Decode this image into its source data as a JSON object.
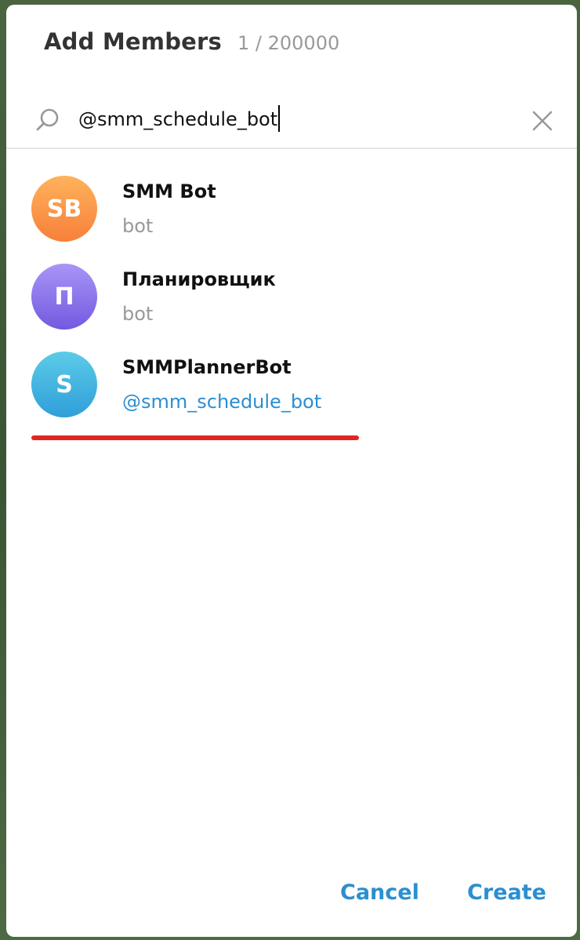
{
  "header": {
    "title": "Add Members",
    "counter": "1 / 200000"
  },
  "search": {
    "value": "@smm_schedule_bot"
  },
  "results": [
    {
      "initials": "SB",
      "name": "SMM Bot",
      "subtitle": "bot",
      "color_top": "#ffb25c",
      "color_bottom": "#f7803a"
    },
    {
      "initials": "П",
      "name": "Планировщик",
      "subtitle": "bot",
      "color_top": "#a995f7",
      "color_bottom": "#7359e0"
    },
    {
      "initials": "S",
      "name": "SMMPlannerBot",
      "subtitle": "@smm_schedule_bot",
      "color_top": "#5ccbe8",
      "color_bottom": "#2f9fd9"
    }
  ],
  "footer": {
    "cancel_label": "Cancel",
    "create_label": "Create"
  },
  "colors": {
    "accent": "#2b8fd0",
    "highlight": "#e32424"
  }
}
